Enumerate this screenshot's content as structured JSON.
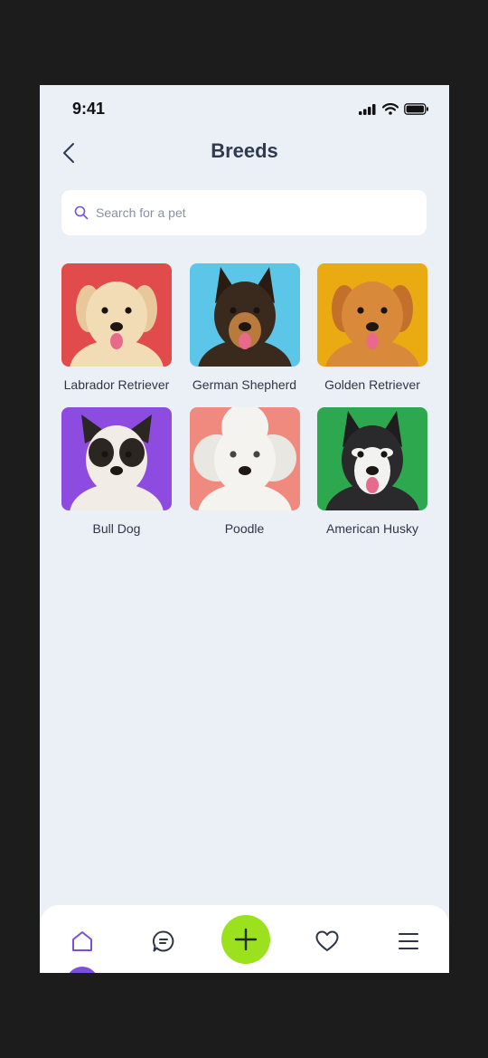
{
  "status": {
    "time": "9:41"
  },
  "header": {
    "title": "Breeds"
  },
  "search": {
    "placeholder": "Search for a pet"
  },
  "breeds": [
    {
      "name": "Labrador Retriever",
      "bg": "#e24b4b",
      "dog": "#f2dcb5",
      "ear": "#e8c79a"
    },
    {
      "name": "German Shepherd",
      "bg": "#5bc6e8",
      "dog": "#3a2a1e",
      "ear": "#2a1c12"
    },
    {
      "name": "Golden Retriever",
      "bg": "#e9aa12",
      "dog": "#d9893a",
      "ear": "#c3702a"
    },
    {
      "name": "Bull Dog",
      "bg": "#8e4be0",
      "dog": "#f1ede6",
      "ear": "#2b2622"
    },
    {
      "name": "Poodle",
      "bg": "#f08a7e",
      "dog": "#f4f3f0",
      "ear": "#e9e7e2"
    },
    {
      "name": "American Husky",
      "bg": "#2da84f",
      "dog": "#2a2a2c",
      "ear": "#1e1e20"
    }
  ],
  "nav": {
    "items": [
      "home-icon",
      "chat-icon",
      "plus-icon",
      "heart-icon",
      "menu-icon"
    ],
    "accent": "#7a4fe0",
    "add_color": "#9be11e"
  }
}
